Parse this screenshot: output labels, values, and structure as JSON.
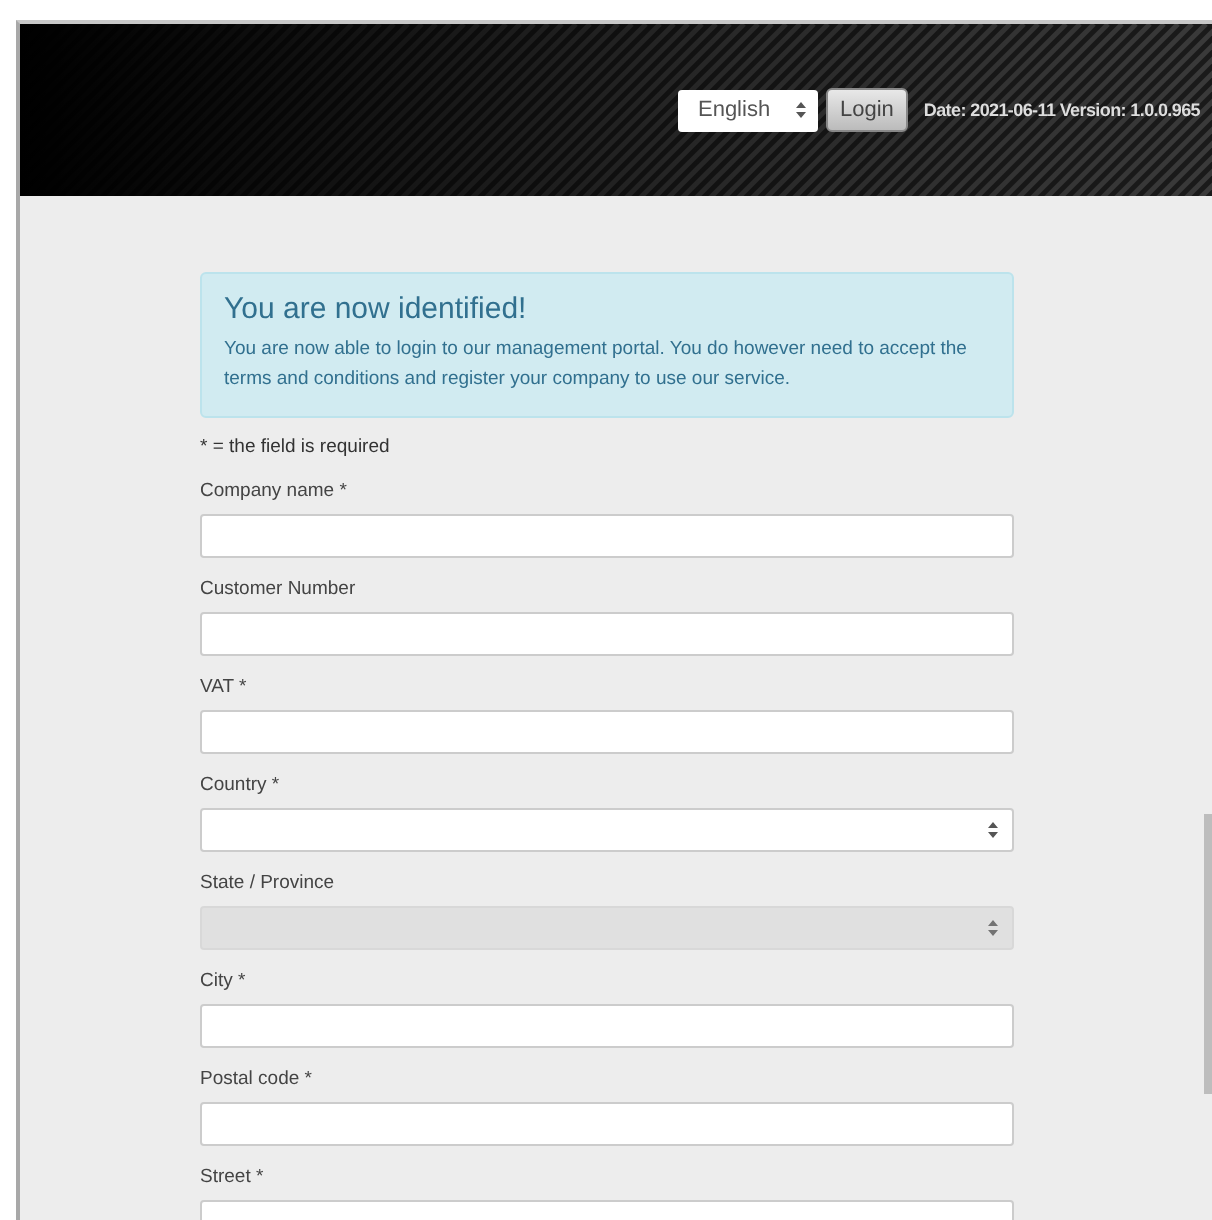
{
  "header": {
    "language": "English",
    "login_button": "Login",
    "date_version": "Date: 2021-06-11 Version: 1.0.0.965"
  },
  "alert": {
    "title": "You are now identified!",
    "text": "You are now able to login to our management portal. You do however need to accept the terms and conditions and register your company to use our service."
  },
  "required_note": "* = the field is required",
  "fields": [
    {
      "label": "Company name *",
      "kind": "text",
      "disabled": false
    },
    {
      "label": "Customer Number",
      "kind": "text",
      "disabled": false
    },
    {
      "label": "VAT *",
      "kind": "text",
      "disabled": false
    },
    {
      "label": "Country *",
      "kind": "select",
      "disabled": false
    },
    {
      "label": "State / Province",
      "kind": "select",
      "disabled": true
    },
    {
      "label": "City *",
      "kind": "text",
      "disabled": false
    },
    {
      "label": "Postal code *",
      "kind": "text",
      "disabled": false
    },
    {
      "label": "Street *",
      "kind": "text",
      "disabled": false
    }
  ]
}
